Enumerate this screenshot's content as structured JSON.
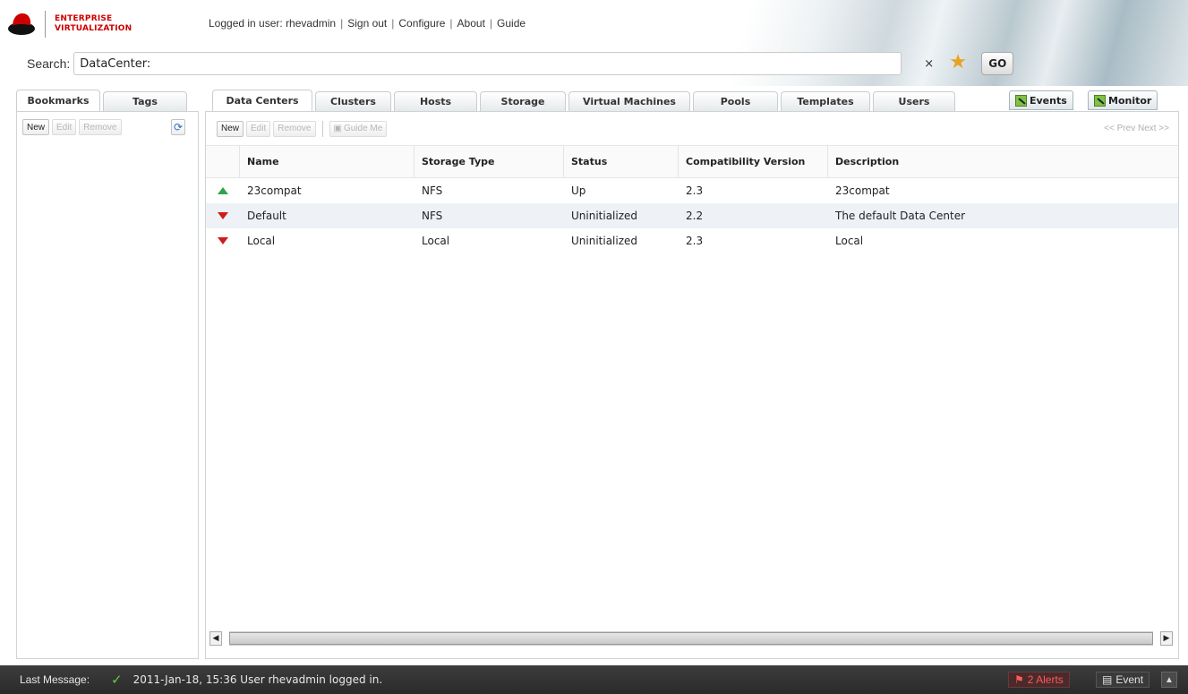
{
  "brand": {
    "line1": "ENTERPRISE",
    "line2": "VIRTUALIZATION"
  },
  "userbar": {
    "logged_in": "Logged in user: rhevadmin",
    "sign_out": "Sign out",
    "configure": "Configure",
    "about": "About",
    "guide": "Guide",
    "separator": "|"
  },
  "search": {
    "label": "Search:",
    "value": "DataCenter:",
    "clear": "×",
    "bookmark_icon": "star-icon",
    "go": "GO"
  },
  "left_tabs": [
    "Bookmarks",
    "Tags"
  ],
  "left_toolbar": {
    "new": "New",
    "edit": "Edit",
    "remove": "Remove",
    "refresh_icon": "refresh-icon"
  },
  "main_tabs": [
    "Data Centers",
    "Clusters",
    "Hosts",
    "Storage",
    "Virtual Machines",
    "Pools",
    "Templates",
    "Users"
  ],
  "right_tabs": {
    "events": "Events",
    "monitor": "Monitor"
  },
  "main_toolbar": {
    "new": "New",
    "edit": "Edit",
    "remove": "Remove",
    "guide_me": "Guide Me",
    "pager": "<< Prev Next >>"
  },
  "grid": {
    "columns": [
      "Name",
      "Storage Type",
      "Status",
      "Compatibility Version",
      "Description"
    ],
    "rows": [
      {
        "status_icon": "up-arrow-icon",
        "name": "23compat",
        "storage_type": "NFS",
        "status": "Up",
        "version": "2.3",
        "description": "23compat"
      },
      {
        "status_icon": "down-arrow-icon",
        "name": "Default",
        "storage_type": "NFS",
        "status": "Uninitialized",
        "version": "2.2",
        "description": "The default Data Center"
      },
      {
        "status_icon": "down-arrow-icon",
        "name": "Local",
        "storage_type": "Local",
        "status": "Uninitialized",
        "version": "2.3",
        "description": "Local"
      }
    ]
  },
  "statusbar": {
    "label": "Last Message:",
    "message": "2011-Jan-18, 15:36 User rhevadmin logged in.",
    "alerts": "2 Alerts",
    "event": "Event"
  },
  "colors": {
    "brand_red": "#cc0000",
    "status_up": "#2fa44a",
    "status_down": "#d01b1b",
    "statusbar_bg": "#333333"
  }
}
